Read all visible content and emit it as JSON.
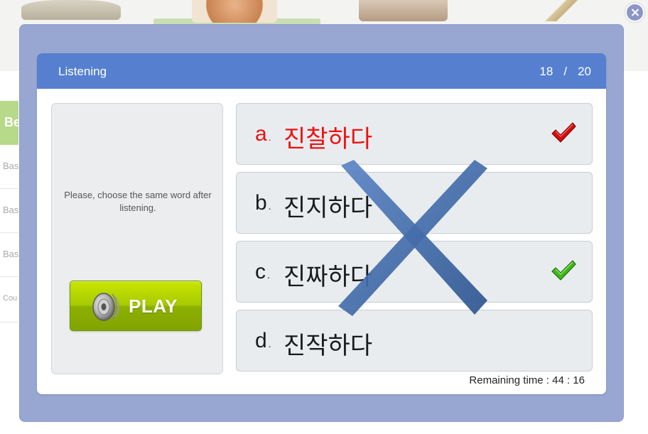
{
  "background": {
    "sidebar_title": "Be",
    "sidebar_items": [
      "Bas",
      "Bas",
      "Bas",
      "Cou"
    ]
  },
  "quiz": {
    "title": "Listening",
    "current": "18",
    "separator": "/",
    "total": "20",
    "instruction": "Please, choose the same word after listening.",
    "play_label": "PLAY",
    "options": [
      {
        "letter": "a",
        "word": "진찰하다",
        "state": "wrong-selected"
      },
      {
        "letter": "b",
        "word": "진지하다",
        "state": "normal"
      },
      {
        "letter": "c",
        "word": "진짜하다",
        "state": "correct"
      },
      {
        "letter": "d",
        "word": "진작하다",
        "state": "normal"
      }
    ],
    "remaining_label": "Remaining time : 44 : 16",
    "result_mark": "incorrect"
  },
  "colors": {
    "header_blue": "#5680cf",
    "overlay": "#98a6d2",
    "wrong_red": "#ee1111",
    "play_green": "#a8cb00",
    "check_green": "#3db81c",
    "check_red": "#d40e0e",
    "x_mark": "#3f67a8"
  },
  "icons": {
    "close": "close-icon",
    "speaker": "speaker-icon",
    "wrong_check": "red-check-icon",
    "correct_check": "green-check-icon",
    "result": "cross-mark-icon"
  }
}
